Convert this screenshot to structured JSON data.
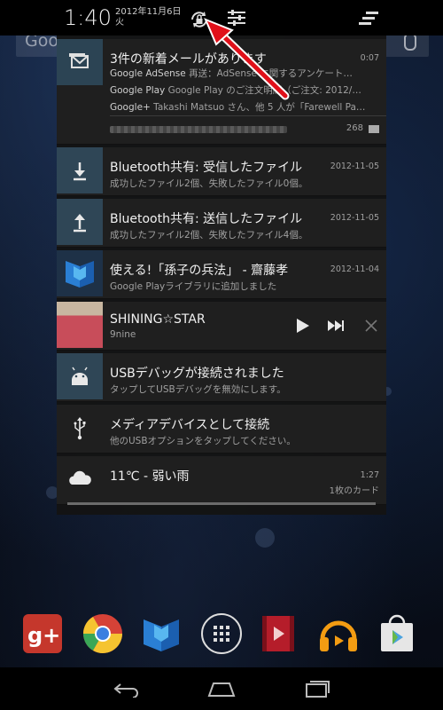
{
  "homescreen": {
    "search_logo_text": "Goo"
  },
  "statusbar": {
    "time": "1:40",
    "date": "2012年11月6日",
    "weekday": "火"
  },
  "notifications": {
    "gmail": {
      "title": "3件の新着メールがあります",
      "time": "0:07",
      "rows": [
        {
          "sender": "Google AdSense",
          "text": " 再送：AdSense に関するアンケート…"
        },
        {
          "sender": "Google Play",
          "text": " Google Play のご注文明細（ご注文: 2012/…"
        },
        {
          "sender": "Google+",
          "text": " Takashi Matsuo さん、他 5 人が「Farewell Pa…"
        }
      ],
      "count": "268"
    },
    "bt_receive": {
      "title": "Bluetooth共有: 受信したファイル",
      "subtitle": "成功したファイル2個、失敗したファイル0個。",
      "time": "2012-11-05"
    },
    "bt_send": {
      "title": "Bluetooth共有: 送信したファイル",
      "subtitle": "成功したファイル2個、失敗したファイル4個。",
      "time": "2012-11-05"
    },
    "book": {
      "title": "使える!「孫子の兵法」 - 齋藤孝",
      "subtitle": "Google Playライブラリに追加しました",
      "time": "2012-11-04"
    },
    "music": {
      "title": "SHINING☆STAR",
      "artist": "9nine"
    },
    "usb_debug": {
      "title": "USBデバッグが接続されました",
      "subtitle": "タップしてUSBデバッグを無効にします。"
    },
    "media_device": {
      "title": "メディアデバイスとして接続",
      "subtitle": "他のUSBオプションをタップしてください。"
    },
    "weather": {
      "title": "11℃ - 弱い雨",
      "time": "1:27",
      "cards": "1枚のカード"
    }
  },
  "dock": {
    "apps": [
      "google-plus-icon",
      "chrome-icon",
      "play-books-icon",
      "app-drawer-icon",
      "play-movies-icon",
      "play-music-icon",
      "play-store-icon"
    ]
  },
  "colors": {
    "accent_arrow": "#e0101a",
    "notification_icon_bg": "#2f4656"
  }
}
